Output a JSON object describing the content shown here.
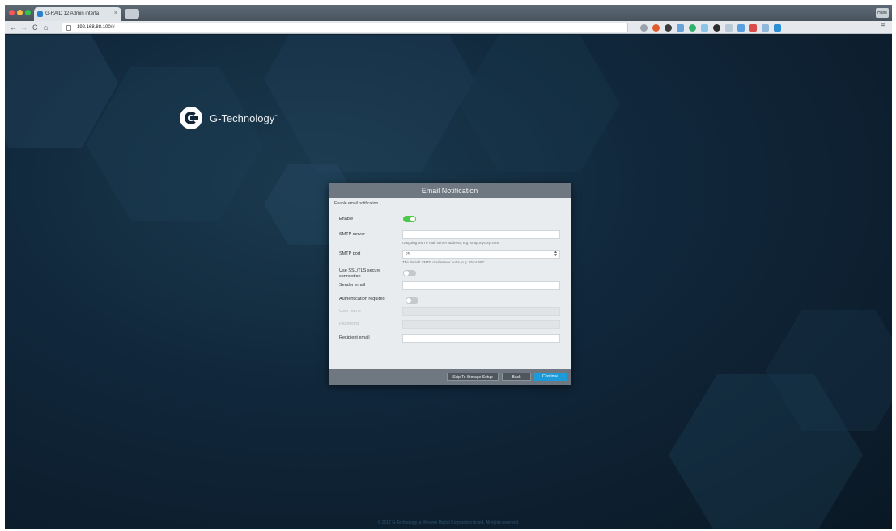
{
  "browser": {
    "tab_title": "G-RAID 12 Admin interfa",
    "tab_close": "×",
    "url": "192.168.88.100/#",
    "back": "←",
    "forward": "→",
    "reload": "C",
    "home": "⌂",
    "menu": "≡",
    "profile": "Hans"
  },
  "brand": {
    "name": "G-Technology",
    "trademark": "™"
  },
  "dialog": {
    "title": "Email Notification",
    "subtitle": "Enable email notification.",
    "enable_label": "Enable",
    "enable_on": true,
    "smtp_server_label": "SMTP server",
    "smtp_server_value": "",
    "smtp_server_hint": "Outgoing SMTP mail server address, e.g. smtp.mycorp.com",
    "smtp_port_label": "SMTP port",
    "smtp_port_value": "25",
    "smtp_port_hint": "The default SMTP mail server ports, e.g. 25 or 587",
    "ssl_label": "Use SSL/TLS secure connection",
    "ssl_on": false,
    "sender_label": "Sender email",
    "sender_value": "",
    "auth_label": "Authentication required",
    "auth_on": false,
    "username_label": "User name",
    "password_label": "Password",
    "recipient_label": "Recipient email",
    "recipient_value": "",
    "buttons": {
      "skip": "Skip To Storage Setup",
      "back": "Back",
      "continue": "Continue"
    }
  },
  "footer_text": "© 2017 G-Technology, a Western Digital Corporation brand. All rights reserved.",
  "colors": {
    "accent": "#1d9ad8",
    "toggle_on": "#4cc94c",
    "background": "#10263a"
  }
}
